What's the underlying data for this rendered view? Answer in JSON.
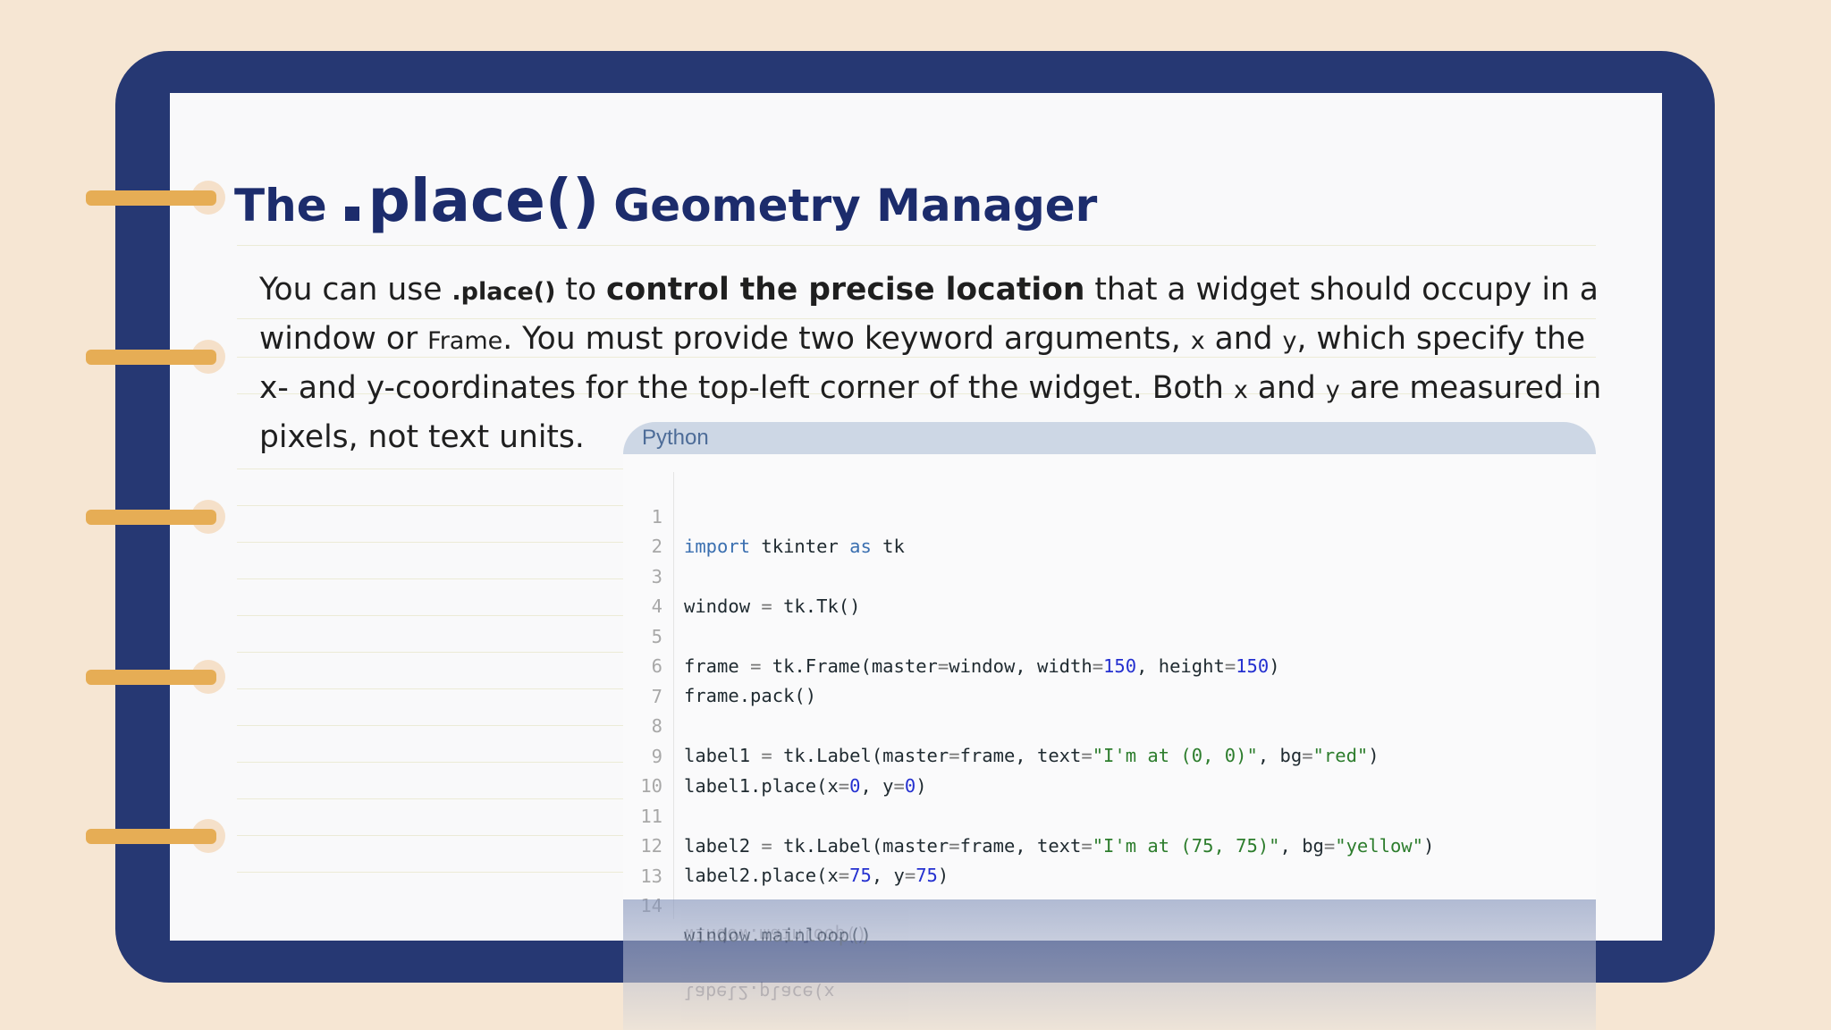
{
  "title": {
    "word1": "The",
    "code": "place()",
    "word2": "Geometry Manager"
  },
  "paragraph": {
    "l1_a": "You can use ",
    "l1_code": ".place()",
    "l1_b": " to ",
    "l1_bold": "control the precise location",
    "l1_c": " that a widget should occupy in a",
    "l2_a": "window or ",
    "l2_code": "Frame",
    "l2_b": ". You must provide two keyword arguments, ",
    "l2_x": "x",
    "l2_c": " and ",
    "l2_y": "y",
    "l2_d": ", which specify the",
    "l3_a": "x- and y-coordinates for the top-left corner of the widget. Both ",
    "l3_x": "x",
    "l3_b": " and ",
    "l3_y": "y",
    "l3_c": " are measured in",
    "l4": "pixels, not text units."
  },
  "code_block": {
    "language": "Python",
    "line_numbers": [
      "1",
      "2",
      "3",
      "4",
      "5",
      "6",
      "7",
      "8",
      "9",
      "10",
      "11",
      "12",
      "13",
      "14"
    ],
    "lines": {
      "l1": {
        "import": "import",
        "mod": " tkinter ",
        "as": "as",
        "alias": " tk"
      },
      "l3": {
        "a": "window ",
        "op": "=",
        "b": " tk.Tk()"
      },
      "l5": {
        "a": "frame ",
        "op": "=",
        "b": " tk.Frame(master",
        "op2": "=",
        "c": "window, width",
        "op3": "=",
        "n1": "150",
        "d": ", height",
        "op4": "=",
        "n2": "150",
        "e": ")"
      },
      "l6": {
        "a": "frame.pack()"
      },
      "l8": {
        "a": "label1 ",
        "op": "=",
        "b": " tk.Label(master",
        "op2": "=",
        "c": "frame, text",
        "op3": "=",
        "s1": "\"I'm at (0, 0)\"",
        "d": ", bg",
        "op4": "=",
        "s2": "\"red\"",
        "e": ")"
      },
      "l9": {
        "a": "label1.place(x",
        "op": "=",
        "n1": "0",
        "b": ", y",
        "op2": "=",
        "n2": "0",
        "c": ")"
      },
      "l11": {
        "a": "label2 ",
        "op": "=",
        "b": " tk.Label(master",
        "op2": "=",
        "c": "frame, text",
        "op3": "=",
        "s1": "\"I'm at (75, 75)\"",
        "d": ", bg",
        "op4": "=",
        "s2": "\"yellow\"",
        "e": ")"
      },
      "l12": {
        "a": "label2.place(x",
        "op": "=",
        "n1": "75",
        "b": ", y",
        "op2": "=",
        "n2": "75",
        "c": ")"
      },
      "l14": {
        "a": "window.mainloop()"
      }
    }
  },
  "colors": {
    "background": "#f6e6d3",
    "binder": "#263873",
    "page": "#f9f9fa",
    "ring": "#e6ad55",
    "title": "#1c2c6c",
    "code_tab": "#cdd7e5"
  }
}
